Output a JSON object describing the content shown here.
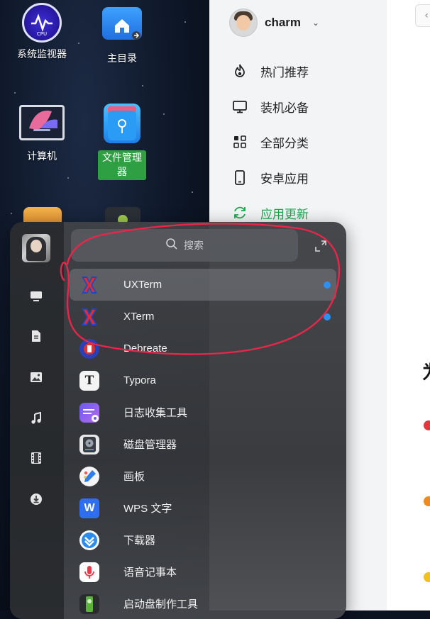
{
  "desktop": {
    "icons": [
      {
        "label": "系统监视器",
        "icon": "system-monitor-icon"
      },
      {
        "label": "主目录",
        "icon": "home-folder-icon"
      },
      {
        "label": "计算机",
        "icon": "computer-icon"
      },
      {
        "label": "文件管理器",
        "icon": "file-manager-icon",
        "selected": true
      }
    ]
  },
  "app_store": {
    "user": "charm",
    "nav": [
      {
        "label": "热门推荐",
        "icon": "fire-icon"
      },
      {
        "label": "装机必备",
        "icon": "monitor-icon"
      },
      {
        "label": "全部分类",
        "icon": "grid-icon"
      },
      {
        "label": "安卓应用",
        "icon": "phone-icon"
      },
      {
        "label": "应用更新",
        "icon": "refresh-icon",
        "active": true
      }
    ],
    "main_heading_fragment": "为",
    "accent_color": "#1ca94e"
  },
  "launcher": {
    "search_placeholder": "搜索",
    "categories": [
      "monitor-icon",
      "document-icon",
      "image-icon",
      "music-icon",
      "film-icon",
      "download-icon"
    ],
    "apps": [
      {
        "name": "UXTerm",
        "icon": "xterm-icon",
        "new": true,
        "highlighted": true
      },
      {
        "name": "XTerm",
        "icon": "xterm-icon",
        "new": true
      },
      {
        "name": "Debreate",
        "icon": "debreate-icon"
      },
      {
        "name": "Typora",
        "icon": "typora-icon"
      },
      {
        "name": "日志收集工具",
        "icon": "log-collector-icon"
      },
      {
        "name": "磁盘管理器",
        "icon": "disk-manager-icon"
      },
      {
        "name": "画板",
        "icon": "drawing-board-icon"
      },
      {
        "name": "WPS 文字",
        "icon": "wps-writer-icon"
      },
      {
        "name": "下载器",
        "icon": "downloader-icon"
      },
      {
        "name": "语音记事本",
        "icon": "voice-notes-icon"
      },
      {
        "name": "启动盘制作工具",
        "icon": "boot-maker-icon"
      }
    ],
    "new_dot_color": "#2d8ff0"
  },
  "annotation_color": "#e8264a"
}
